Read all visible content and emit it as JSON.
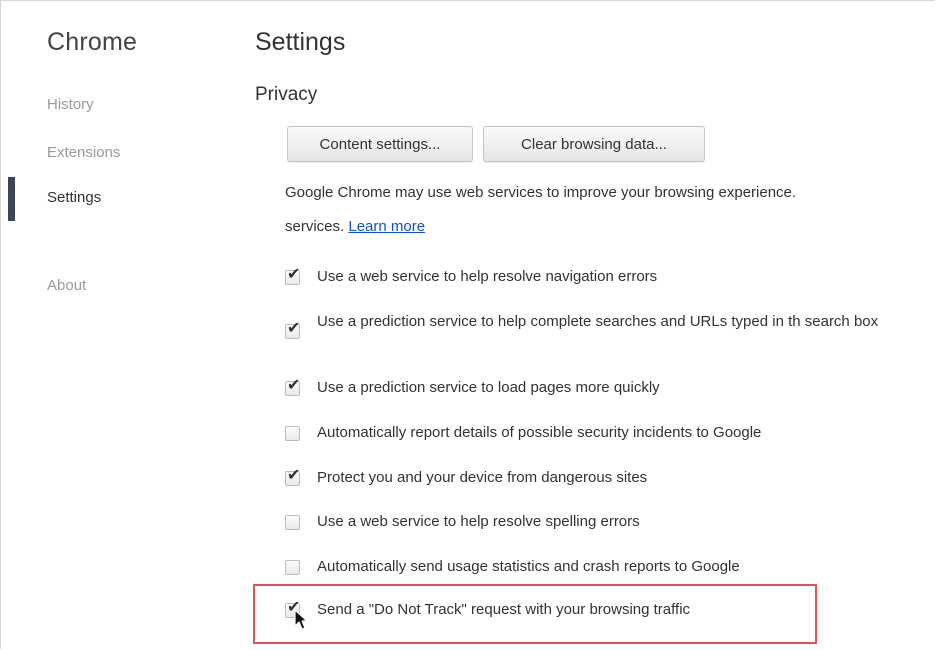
{
  "sidebar": {
    "brand": "Chrome",
    "items": [
      {
        "label": "History",
        "active": false
      },
      {
        "label": "Extensions",
        "active": false
      },
      {
        "label": "Settings",
        "active": true
      },
      {
        "label": "About",
        "active": false
      }
    ]
  },
  "main": {
    "title": "Settings",
    "section": "Privacy",
    "buttons": {
      "content_settings": "Content settings...",
      "clear_browsing_data": "Clear browsing data..."
    },
    "description": {
      "line1": "Google Chrome may use web services to improve your browsing experience.",
      "line2": "services.",
      "learn_more": "Learn more"
    },
    "options": [
      {
        "label": "Use a web service to help resolve navigation errors",
        "checked": true
      },
      {
        "label": "Use a prediction service to help complete searches and URLs typed in th search box",
        "checked": true
      },
      {
        "label": "Use a prediction service to load pages more quickly",
        "checked": true
      },
      {
        "label": "Automatically report details of possible security incidents to Google",
        "checked": false
      },
      {
        "label": "Protect you and your device from dangerous sites",
        "checked": true
      },
      {
        "label": "Use a web service to help resolve spelling errors",
        "checked": false
      },
      {
        "label": "Automatically send usage statistics and crash reports to Google",
        "checked": false
      },
      {
        "label": "Send a \"Do Not Track\" request with your browsing traffic",
        "checked": true,
        "highlighted": true
      }
    ]
  },
  "colors": {
    "highlight_border": "#e05552",
    "link": "#1155cc",
    "nav_marker": "#3b4656"
  }
}
